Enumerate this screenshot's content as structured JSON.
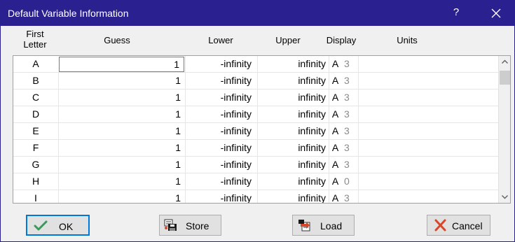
{
  "window": {
    "title": "Default Variable Information",
    "help_glyph": "?"
  },
  "headers": {
    "first_letter": "First\nLetter",
    "guess": "Guess",
    "lower": "Lower",
    "upper": "Upper",
    "display": "Display",
    "units": "Units"
  },
  "rows": [
    {
      "letter": "A",
      "guess": "1",
      "lower": "-infinity",
      "upper": "infinity",
      "display_fmt": "A",
      "display_digits": "3",
      "units": ""
    },
    {
      "letter": "B",
      "guess": "1",
      "lower": "-infinity",
      "upper": "infinity",
      "display_fmt": "A",
      "display_digits": "3",
      "units": ""
    },
    {
      "letter": "C",
      "guess": "1",
      "lower": "-infinity",
      "upper": "infinity",
      "display_fmt": "A",
      "display_digits": "3",
      "units": ""
    },
    {
      "letter": "D",
      "guess": "1",
      "lower": "-infinity",
      "upper": "infinity",
      "display_fmt": "A",
      "display_digits": "3",
      "units": ""
    },
    {
      "letter": "E",
      "guess": "1",
      "lower": "-infinity",
      "upper": "infinity",
      "display_fmt": "A",
      "display_digits": "3",
      "units": ""
    },
    {
      "letter": "F",
      "guess": "1",
      "lower": "-infinity",
      "upper": "infinity",
      "display_fmt": "A",
      "display_digits": "3",
      "units": ""
    },
    {
      "letter": "G",
      "guess": "1",
      "lower": "-infinity",
      "upper": "infinity",
      "display_fmt": "A",
      "display_digits": "3",
      "units": ""
    },
    {
      "letter": "H",
      "guess": "1",
      "lower": "-infinity",
      "upper": "infinity",
      "display_fmt": "A",
      "display_digits": "0",
      "units": ""
    },
    {
      "letter": "I",
      "guess": "1",
      "lower": "-infinity",
      "upper": "infinity",
      "display_fmt": "A",
      "display_digits": "3",
      "units": ""
    }
  ],
  "buttons": {
    "ok": "OK",
    "store": "Store",
    "load": "Load",
    "cancel": "Cancel"
  },
  "colors": {
    "titlebar": "#2b2090",
    "ok_check": "#3a9a5b",
    "cancel_x": "#d9472b",
    "focus": "#0078d7"
  },
  "icons": {
    "ok": "checkmark-icon",
    "store": "floppy-disk-icon",
    "load": "load-arrow-icon",
    "cancel": "x-icon",
    "close": "close-icon"
  }
}
